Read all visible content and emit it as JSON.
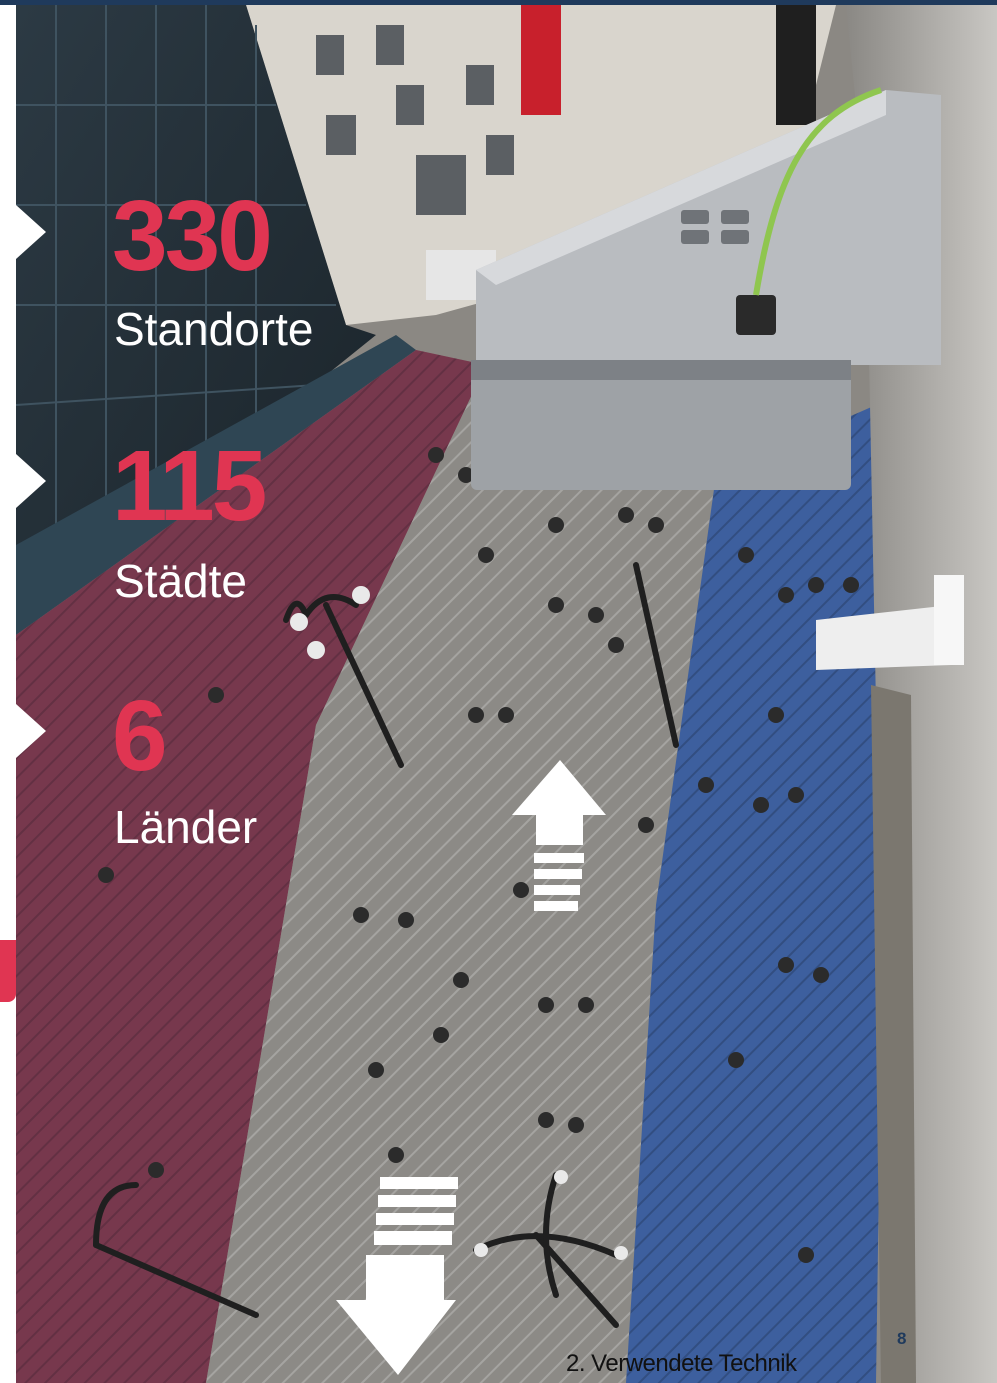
{
  "stats": [
    {
      "value": "330",
      "label": "Standorte"
    },
    {
      "value": "115",
      "label": "Städte"
    },
    {
      "value": "6",
      "label": "Länder"
    }
  ],
  "footer": {
    "section_title": "2. Verwendete Technik",
    "page_number": "8"
  },
  "colors": {
    "accent": "#e03552",
    "navy": "#1f3a5c",
    "zone_red": "#b0314a",
    "zone_blue": "#2a4f9a"
  }
}
